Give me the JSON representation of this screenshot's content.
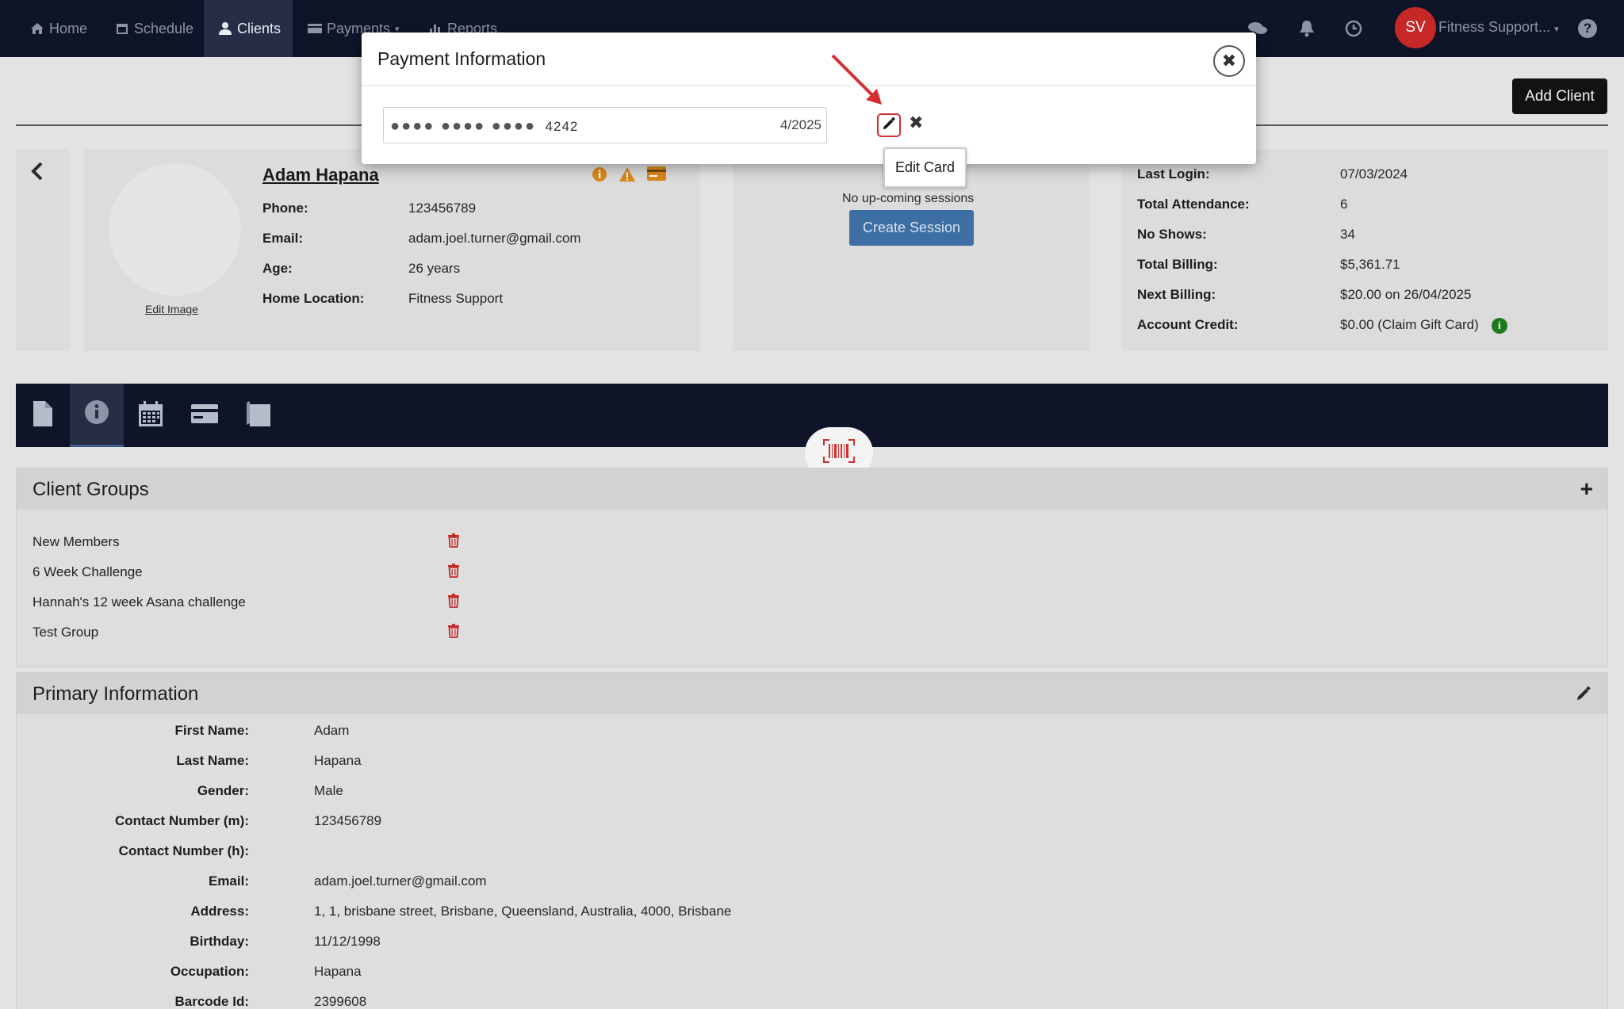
{
  "nav": {
    "items": [
      {
        "label": "Home",
        "icon": "home-icon"
      },
      {
        "label": "Schedule",
        "icon": "calendar-icon"
      },
      {
        "label": "Clients",
        "icon": "user-icon"
      },
      {
        "label": "Payments",
        "icon": "card-icon"
      },
      {
        "label": "Reports",
        "icon": "chart-icon"
      }
    ],
    "avatar_initials": "SV",
    "account_name": "Fitness Support...",
    "help_label": "?"
  },
  "actions": {
    "add_client": "Add Client"
  },
  "profile": {
    "name": "Adam Hapana",
    "edit_image": "Edit Image",
    "fields": [
      {
        "label": "Phone:",
        "value": "123456789"
      },
      {
        "label": "Email:",
        "value": "adam.joel.turner@gmail.com"
      },
      {
        "label": "Age:",
        "value": "26 years"
      },
      {
        "label": "Home Location:",
        "value": "Fitness Support"
      }
    ]
  },
  "sessions": {
    "upcoming": "No up-coming sessions",
    "create": "Create Session"
  },
  "stats": [
    {
      "label": "Last Login:",
      "value": "07/03/2024"
    },
    {
      "label": "Total Attendance:",
      "value": "6"
    },
    {
      "label": "No Shows:",
      "value": "34"
    },
    {
      "label": "Total Billing:",
      "value": "$5,361.71"
    },
    {
      "label": "Next Billing:",
      "value": "$20.00 on 26/04/2025"
    },
    {
      "label": "Account Credit:",
      "value": "$0.00 (Claim Gift Card)"
    }
  ],
  "client_groups": {
    "title": "Client Groups",
    "items": [
      "New Members",
      "6 Week Challenge",
      "Hannah's 12 week Asana challenge",
      "Test Group"
    ]
  },
  "primary_info": {
    "title": "Primary Information",
    "fields": [
      {
        "label": "First Name:",
        "value": "Adam"
      },
      {
        "label": "Last Name:",
        "value": "Hapana"
      },
      {
        "label": "Gender:",
        "value": "Male"
      },
      {
        "label": "Contact Number (m):",
        "value": "123456789"
      },
      {
        "label": "Contact Number (h):",
        "value": ""
      },
      {
        "label": "Email:",
        "value": "adam.joel.turner@gmail.com"
      },
      {
        "label": "Address:",
        "value": "1, 1, brisbane street, Brisbane, Queensland, Australia, 4000, Brisbane"
      },
      {
        "label": "Birthday:",
        "value": "11/12/1998"
      },
      {
        "label": "Occupation:",
        "value": "Hapana"
      },
      {
        "label": "Barcode Id:",
        "value": "2399608"
      }
    ]
  },
  "modal": {
    "title": "Payment Information",
    "card_dots": "●●●● ●●●● ●●●●",
    "card_last4": "4242",
    "card_expiry": "4/2025",
    "tooltip": "Edit Card",
    "close": "✖",
    "remove": "✖"
  },
  "colors": {
    "nav_bg": "#0f1428",
    "accent_red": "#d32f2f",
    "button_blue": "#3d6fa5"
  }
}
